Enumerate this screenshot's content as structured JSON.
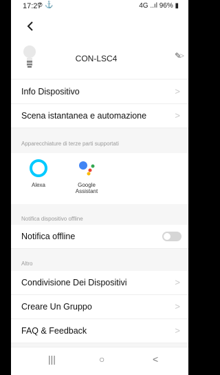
{
  "status": {
    "time": "17:27",
    "icons": "⊙ ⚓",
    "right": "4G ..ıl 96% ▮"
  },
  "device": {
    "name": "CON-LSC4"
  },
  "menu": {
    "info": "Info Dispositivo",
    "scene": "Scena istantanea e automazione",
    "third_party_section": "Apparecchiature di terze parti supportati",
    "third_party": [
      {
        "label": "Alexa"
      },
      {
        "label": "Google\nAssistant"
      }
    ],
    "offline_section": "Notifica dispositivo offline",
    "offline_notify": "Notifica offline",
    "other_section": "Altro",
    "share": "Condivisione Dei Dispositivi",
    "group": "Creare Un Gruppo",
    "faq": "FAQ & Feedback"
  },
  "nav": {
    "recent": "|||",
    "home": "○",
    "back": "<"
  },
  "colors": {
    "alexa": "#00caff",
    "google_blue": "#4285f4",
    "google_red": "#ea4335",
    "google_yellow": "#fbbc05",
    "google_green": "#34a853",
    "toggle_off": "#d6d6d6"
  }
}
